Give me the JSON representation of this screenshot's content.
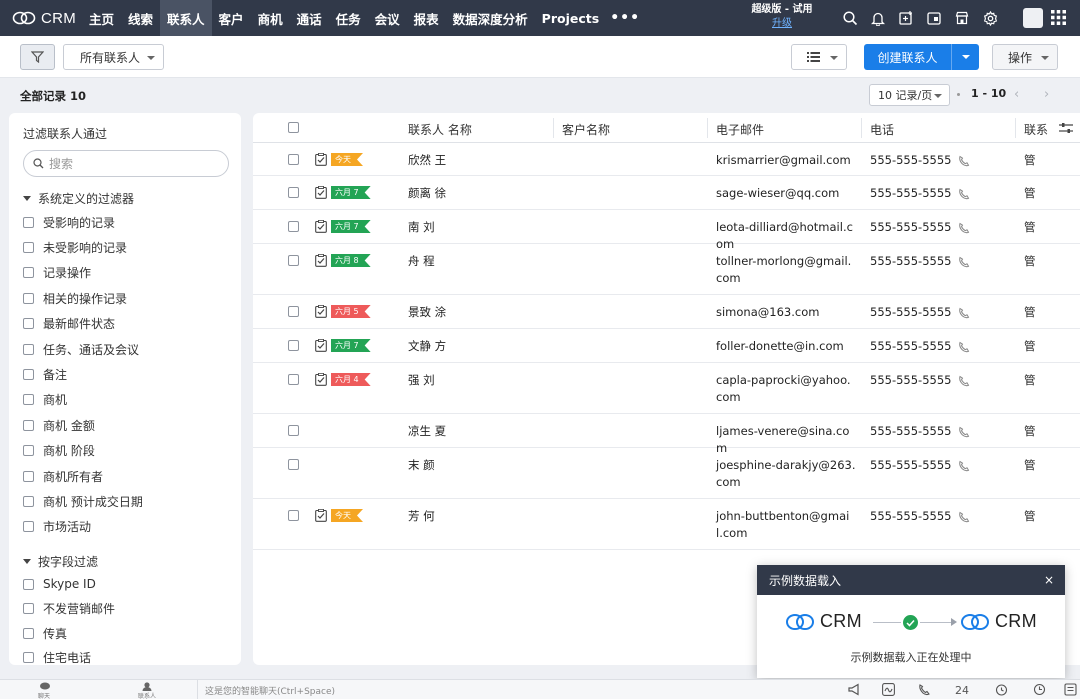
{
  "app": {
    "brand": "CRM"
  },
  "nav": {
    "items": [
      {
        "label": "主页",
        "active": false
      },
      {
        "label": "线索",
        "active": false
      },
      {
        "label": "联系人",
        "active": true
      },
      {
        "label": "客户",
        "active": false
      },
      {
        "label": "商机",
        "active": false
      },
      {
        "label": "通话",
        "active": false
      },
      {
        "label": "任务",
        "active": false
      },
      {
        "label": "会议",
        "active": false
      },
      {
        "label": "报表",
        "active": false
      },
      {
        "label": "数据深度分析",
        "active": false
      },
      {
        "label": "Projects",
        "active": false
      }
    ],
    "more": "•••",
    "edition": "超级版 - 试用",
    "upgrade": "升级",
    "icons": [
      "search-icon",
      "bell-icon",
      "add-note-icon",
      "calendar-icon",
      "store-icon",
      "settings-icon"
    ]
  },
  "toolbar": {
    "view_name": "所有联系人",
    "create_label": "创建联系人",
    "ops_label": "操作"
  },
  "summary": {
    "label": "全部记录",
    "count": "10",
    "per_page": "10 记录/页",
    "range": "1 - 10"
  },
  "filters": {
    "title": "过滤联系人通过",
    "search_placeholder": "搜索",
    "system_section": "系统定义的过滤器",
    "system_items": [
      "受影响的记录",
      "未受影响的记录",
      "记录操作",
      "相关的操作记录",
      "最新邮件状态",
      "任务、通话及会议",
      "备注",
      "商机",
      "商机 金额",
      "商机 阶段",
      "商机所有者",
      "商机 预计成交日期",
      "市场活动"
    ],
    "field_section": "按字段过滤",
    "field_items": [
      "Skype ID",
      "不发营销邮件",
      "传真",
      "住宅电话"
    ]
  },
  "table": {
    "columns": [
      "联系人 名称",
      "客户名称",
      "电子邮件",
      "电话",
      "联系人"
    ],
    "columns_short": [
      "联系人 名称",
      "客户名称",
      "电子邮件",
      "电话",
      "联系"
    ],
    "rows": [
      {
        "name": "欣然 王",
        "email": "krismarrier@gmail.com",
        "phone": "555-555-5555",
        "owner": "管",
        "tag": "今天",
        "tag_color": "orange"
      },
      {
        "name": "颜离 徐",
        "email": "sage-wieser@qq.com",
        "phone": "555-555-5555",
        "owner": "管",
        "tag": "六月 7",
        "tag_color": "green"
      },
      {
        "name": "南 刘",
        "email": "leota-dilliard@hotmail.com",
        "phone": "555-555-5555",
        "owner": "管",
        "tag": "六月 7",
        "tag_color": "green"
      },
      {
        "name": "舟 程",
        "email": "tollner-morlong@gmail.com",
        "phone": "555-555-5555",
        "owner": "管",
        "tag": "六月 8",
        "tag_color": "green"
      },
      {
        "name": "景致 涂",
        "email": "simona@163.com",
        "phone": "555-555-5555",
        "owner": "管",
        "tag": "六月 5",
        "tag_color": "red"
      },
      {
        "name": "文静 方",
        "email": "foller-donette@in.com",
        "phone": "555-555-5555",
        "owner": "管",
        "tag": "六月 7",
        "tag_color": "green"
      },
      {
        "name": "强 刘",
        "email": "capla-paprocki@yahoo.com",
        "phone": "555-555-5555",
        "owner": "管",
        "tag": "六月 4",
        "tag_color": "red"
      },
      {
        "name": "凉生 夏",
        "email": "ljames-venere@sina.com",
        "phone": "555-555-5555",
        "owner": "管",
        "tag": "",
        "tag_color": ""
      },
      {
        "name": "末 颜",
        "email": "joesphine-darakjy@263.com",
        "phone": "555-555-5555",
        "owner": "管",
        "tag": "",
        "tag_color": ""
      },
      {
        "name": "芳 何",
        "email": "john-buttbenton@gmail.com",
        "phone": "555-555-5555",
        "owner": "管",
        "tag": "今天",
        "tag_color": "orange"
      }
    ]
  },
  "popup": {
    "title": "示例数据载入",
    "close": "×",
    "logo_left": "CRM",
    "logo_right": "CRM",
    "message": "示例数据载入正在处理中"
  },
  "bottombar": {
    "left_labels": [
      "聊天",
      "联系人"
    ],
    "chat_placeholder": "这是您的智能聊天(Ctrl+Space)"
  },
  "colors": {
    "nav_bg": "#313949",
    "primary": "#1a7ee8",
    "tag_orange": "#f5a623",
    "tag_green": "#23a455",
    "tag_red": "#ee5a5a"
  }
}
